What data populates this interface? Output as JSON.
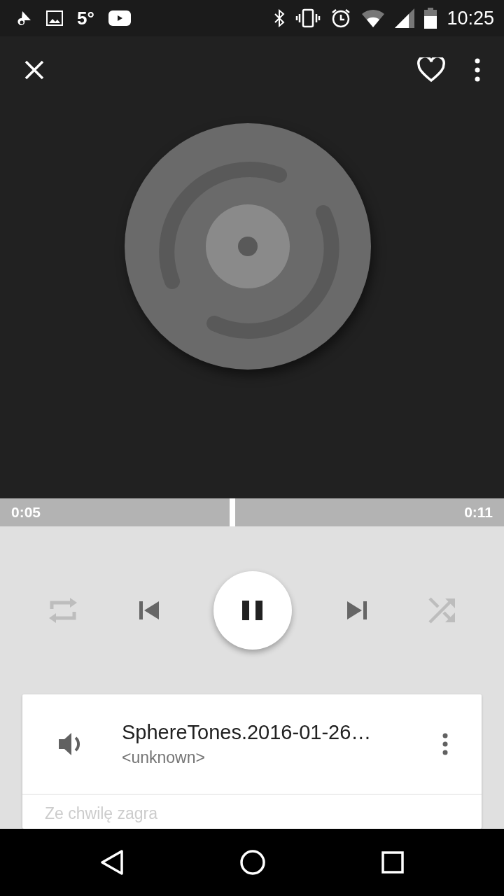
{
  "status_bar": {
    "temperature": "5°",
    "time": "10:25"
  },
  "player": {
    "favorite": false,
    "playing": true,
    "repeat": false,
    "shuffle": false
  },
  "seek": {
    "elapsed": "0:05",
    "total": "0:11",
    "level": 0.455
  },
  "queue": {
    "items": [
      {
        "title": "SphereTones.2016-01-26…",
        "artist": "<unknown>",
        "now_playing": true
      }
    ],
    "up_next": "Ze chwilę zagra"
  }
}
